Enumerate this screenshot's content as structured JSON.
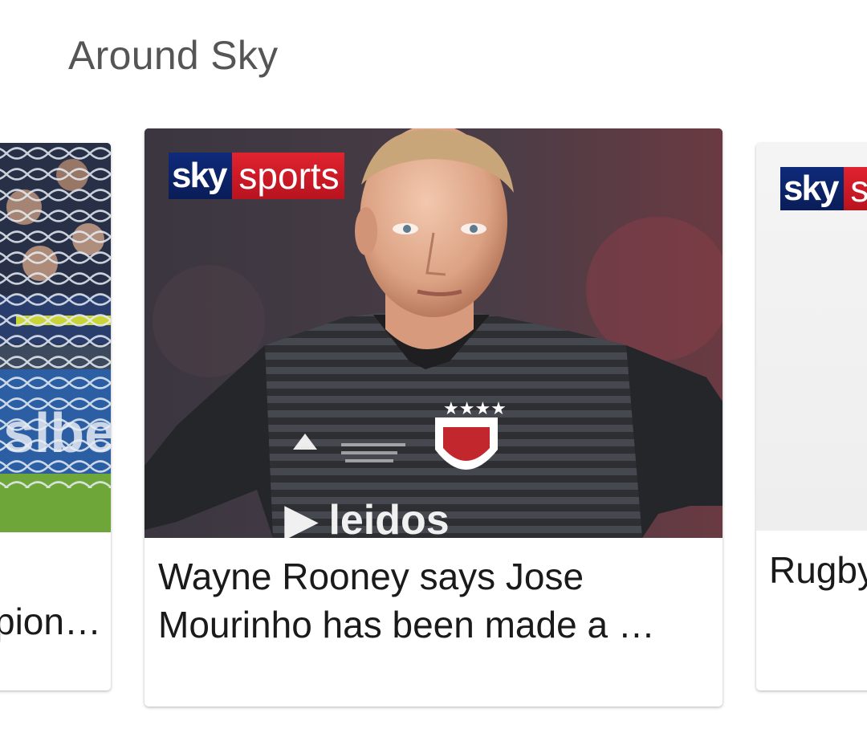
{
  "section": {
    "title": "Around Sky"
  },
  "cards": [
    {
      "title": "pion…",
      "image": "football-goal-net-crowd"
    },
    {
      "title": "Wayne Rooney says Jose Mourinho has been made a …",
      "image": "footballer-dc-united-kit",
      "logo": {
        "brand": "sky",
        "channel": "sports"
      }
    },
    {
      "title": "Rugby",
      "image": "rugby-placeholder",
      "logo": {
        "brand": "sky",
        "channel": "s"
      }
    }
  ],
  "colors": {
    "sky_blue": "#0e2a7a",
    "sky_red": "#e0232f",
    "title_gray": "#555555",
    "card_text": "#1a1a1a"
  }
}
